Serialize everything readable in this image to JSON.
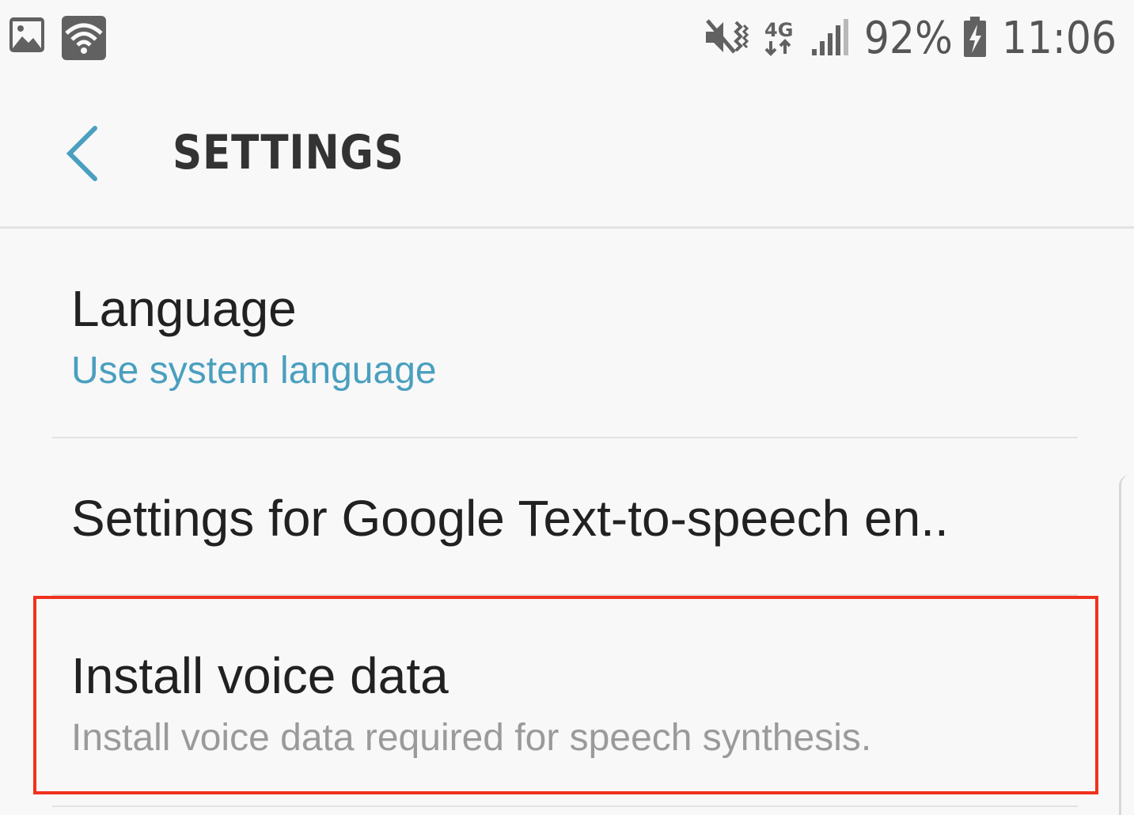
{
  "status_bar": {
    "battery": "92%",
    "time": "11:06",
    "network": "4G",
    "icons": [
      "gallery-icon",
      "wifi-icon",
      "vibrate-mute-icon",
      "data-4g-icon",
      "signal-icon",
      "battery-charging-icon"
    ]
  },
  "header": {
    "title": "SETTINGS",
    "back_icon": "chevron-left-icon"
  },
  "settings": {
    "language": {
      "title": "Language",
      "value": "Use system language"
    },
    "engine": {
      "title": "Settings for Google Text-to-speech en.."
    },
    "voice_data": {
      "title": "Install voice data",
      "summary": "Install voice data required for speech synthesis."
    }
  },
  "colors": {
    "accent": "#4a9fbf",
    "highlight": "#f0321e",
    "background": "#f8f8f8"
  }
}
